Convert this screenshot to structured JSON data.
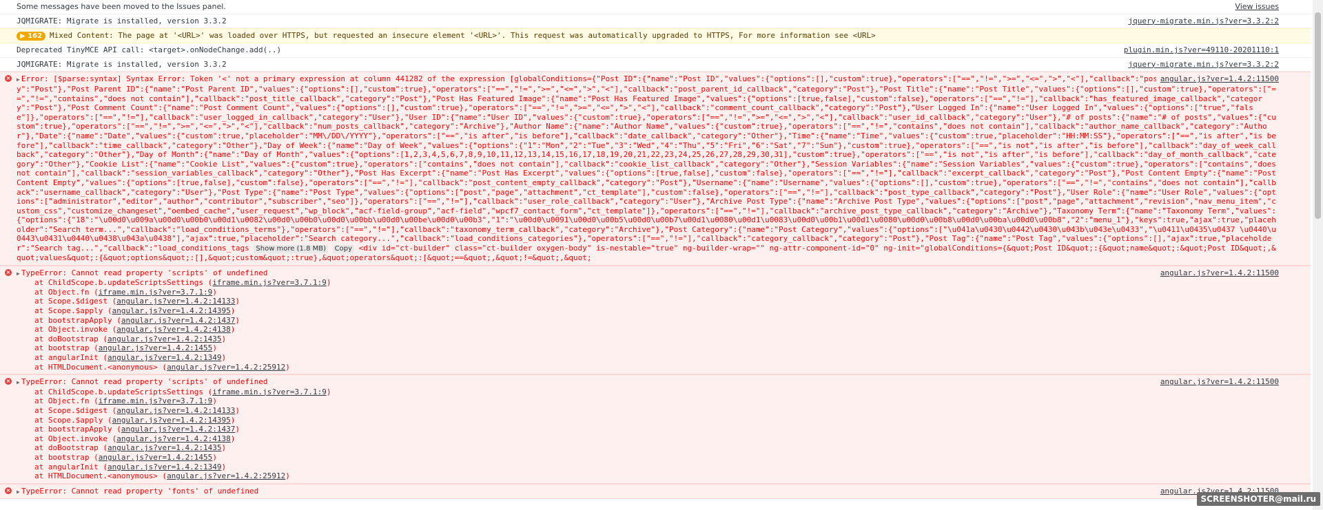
{
  "rows": [
    {
      "type": "info",
      "text": "Some messages have been moved to the Issues panel.",
      "src": "View issues"
    },
    {
      "type": "log",
      "text": "JQMIGRATE: Migrate is installed, version 3.3.2",
      "src": "jquery-migrate.min.js?ver=3.3.2:2"
    },
    {
      "type": "warn",
      "badge": "162",
      "text": "Mixed Content: The page at '<URL>' was loaded over HTTPS, but requested an insecure element '<URL>'. This request was automatically upgraded to HTTPS, For more information see <URL>",
      "src": ""
    },
    {
      "type": "log",
      "text": "Deprecated TinyMCE API call: <target>.onNodeChange.add(..)",
      "src": "plugin.min.js?ver=49110-20201110:1"
    },
    {
      "type": "log",
      "text": "JQMIGRATE: Migrate is installed, version 3.3.2",
      "src": "jquery-migrate.min.js?ver=3.3.2:2"
    },
    {
      "type": "error",
      "text": "Error: [$parse:syntax] Syntax Error: Token '<' not a primary expression at column 441282 of the expression [globalConditions={\"Post ID\":{\"name\":\"Post ID\",\"values\":{\"options\":[],\"custom\":true},\"operators\":[\"==\",\"!=\",\">=\",\"<=\",\">\",\"<\"],\"callback\":\"post_id_callback\",\"category\":\"Post\"},\"Post Parent ID\":{\"name\":\"Post Parent ID\",\"values\":{\"options\":[],\"custom\":true},\"operators\":[\"==\",\"!=\",\">=\",\"<=\",\">\",\"<\"],\"callback\":\"post_parent_id_callback\",\"category\":\"Post\"},\"Post Title\":{\"name\":\"Post Title\",\"values\":{\"options\":[],\"custom\":true},\"operators\":[\"==\",\"!=\",\"contains\",\"does not contain\"],\"callback\":\"post_title_callback\",\"category\":\"Post\"},\"Post Has Featured Image\":{\"name\":\"Post Has Featured Image\",\"values\":{\"options\":[true,false],\"custom\":false},\"operators\":[\"==\",\"!=\"],\"callback\":\"has_featured_image_callback\",\"category\":\"Post\"},\"Post Comment Count\":{\"name\":\"Post Comment Count\",\"values\":{\"options\":[],\"custom\":true},\"operators\":[\"==\",\"!=\",\">=\",\"<=\",\">\",\"<\"],\"callback\":\"comment_count_callback\",\"category\":\"Post\"},\"User Logged In\":{\"name\":\"User Logged In\",\"values\":{\"options\":[\"true\",\"false\"]},\"operators\":[\"==\",\"!=\"],\"callback\":\"user_logged_in_callback\",\"category\":\"User\"},\"User ID\":{\"name\":\"User ID\",\"values\":{\"custom\":true},\"operators\":[\"==\",\"!=\",\">=\",\"<=\",\">\",\"<\"],\"callback\":\"user_id_callback\",\"category\":\"User\"},\"# of posts\":{\"name\":\"# of posts\",\"values\":{\"custom\":true},\"operators\":[\"==\",\"!=\",\">=\",\"<=\",\">\",\"<\"],\"callback\":\"num_posts_callback\",\"category\":\"Archive\"},\"Author Name\":{\"name\":\"Author Name\",\"values\":{\"custom\":true},\"operators\":[\"==\",\"!=\",\"contains\",\"does not contain\"],\"callback\":\"author_name_callback\",\"category\":\"Author\"},\"Date\":{\"name\":\"Date\",\"values\":{\"custom\":true,\"placeholder\":\"MM\\/DD\\/YYYY\"},\"operators\":[\"==\",\"is after\",\"is before\"],\"callback\":\"date_callback\",\"category\":\"Other\"},\"Time\":{\"name\":\"Time\",\"values\":{\"custom\":true,\"placeholder\":\"HH:MM:SS\"},\"operators\":[\"==\",\"is after\",\"is before\"],\"callback\":\"time_callback\",\"category\":\"Other\"},\"Day of Week\":{\"name\":\"Day of Week\",\"values\":{\"options\":{\"1\":\"Mon\",\"2\":\"Tue\",\"3\":\"Wed\",\"4\":\"Thu\",\"5\":\"Fri\",\"6\":\"Sat\",\"7\":\"Sun\"},\"custom\":true},\"operators\":[\"==\",\"is not\",\"is after\",\"is before\"],\"callback\":\"day_of_week_callback\",\"category\":\"Other\"},\"Day of Month\":{\"name\":\"Day of Month\",\"values\":{\"options\":[1,2,3,4,5,6,7,8,9,10,11,12,13,14,15,16,17,18,19,20,21,22,23,24,25,26,27,28,29,30,31],\"custom\":true},\"operators\":[\"==\",\"is not\",\"is after\",\"is before\"],\"callback\":\"day_of_month_callback\",\"category\":\"Other\"},\"Cookie List\":{\"name\":\"Cookie List\",\"values\":{\"custom\":true},\"operators\":[\"contains\",\"does not contain\"],\"callback\":\"cookie_list_callback\",\"category\":\"Other\"},\"Session Variables\":{\"name\":\"Session Variables\",\"values\":{\"custom\":true},\"operators\":[\"contains\",\"does not contain\"],\"callback\":\"session_variables_callback\",\"category\":\"Other\"},\"Post Has Excerpt\":{\"name\":\"Post Has Excerpt\",\"values\":{\"options\":[true,false],\"custom\":false},\"operators\":[\"==\",\"!=\"],\"callback\":\"excerpt_callback\",\"category\":\"Post\"},\"Post Content Empty\":{\"name\":\"Post Content Empty\",\"values\":{\"options\":[true,false],\"custom\":false},\"operators\":[\"==\",\"!=\"],\"callback\":\"post_content_empty_callback\",\"category\":\"Post\"},\"Username\":{\"name\":\"Username\",\"values\":{\"options\":[],\"custom\":true},\"operators\":[\"==\",\"!=\",\"contains\",\"does not contain\"],\"callback\":\"username_callback\",\"category\":\"User\"},\"Post Type\":{\"name\":\"Post Type\",\"values\":{\"options\":[\"post\",\"page\",\"attachment\",\"ct_template\"],\"custom\":false},\"operators\":[\"==\",\"!=\"],\"callback\":\"post_type_callback\",\"category\":\"Post\"},\"User Role\":{\"name\":\"User Role\",\"values\":{\"options\":[\"administrator\",\"editor\",\"author\",\"contributor\",\"subscriber\",\"seo\"]},\"operators\":[\"==\",\"!=\"],\"callback\":\"user_role_callback\",\"category\":\"User\"},\"Archive Post Type\":{\"name\":\"Archive Post Type\",\"values\":{\"options\":[\"post\",\"page\",\"attachment\",\"revision\",\"nav_menu_item\",\"custom_css\",\"customize_changeset\",\"oembed_cache\",\"user_request\",\"wp_block\",\"acf-field-group\",\"acf-field\",\"wpcf7_contact_form\",\"ct_template\"]},\"operators\":[\"==\",\"!=\"],\"callback\":\"archive_post_type_callback\",\"category\":\"Archive\"},\"Taxonomy Term\":{\"name\":\"Taxonomy Term\",\"values\":{\"options\":{\"18\":\"\\u00d0\\u009a\\u00d0\\u00b0\\u00d1\\u0082\\u00d0\\u00b0\\u00d0\\u00bb\\u00d0\\u00be\\u00d0\\u00b3\",\"1\":\"\\u00d0\\u0091\\u00d0\\u00b5\\u00d0\\u00b7\\u00d1\\u0080\\u00d1\\u0083\\u00d0\\u00b1\\u00d1\\u0080\\u00d0\\u00b8\\u00d0\\u00ba\\u00d0\\u00b8\",\"2\":\"menu_1\"},\"keys\":true,\"ajax\":true,\"placeholder\":\"Search term...\",\"callback\":\"load_conditions_terms\"},\"operators\":[\"==\",\"!=\"],\"callback\":\"taxonomy_term_callback\",\"category\":\"Archive\"},\"Post Category\":{\"name\":\"Post Category\",\"values\":{\"options\":[\"\\u041a\\u0430\\u0442\\u0430\\u043b\\u043e\\u0433\",\"\\u0411\\u0435\\u0437 \\u0440\\u0443\\u0431\\u0440\\u0438\\u043a\\u0438\"],\"ajax\":true,\"placeholder\":\"Search category...\",\"callback\":\"load_conditions_categories\"},\"operators\":[\"==\",\"!=\"],\"callback\":\"category_callback\",\"category\":\"Post\"},\"Post Tag\":{\"name\":\"Post Tag\",\"values\":{\"options\":[],\"ajax\":true,\"placeholder\":\"Search tag...\",\"callback\":\"load_conditions_tags",
      "showmore": "Show more (1.8 MB)",
      "copy": "Copy",
      "tail": " <div id=\"ct-builder\" class=\"ct-builder oxygen-body\" is-nestable=\"true\" ng-builder-wrap=\"\" ng-attr-component-id=\"0\" ng-init=\"globalConditions={&quot;Post ID&quot;:{&quot;name&quot;:&quot;Post ID&quot;,&quot;values&quot;:{&quot;options&quot;:[],&quot;custom&quot;:true},&quot;operators&quot;:[&quot;==&quot;,&quot;!=&quot;,&quot;",
      "src": "angular.js?ver=1.4.2:11500"
    },
    {
      "type": "stack",
      "text": "TypeError: Cannot read property 'scripts' of undefined",
      "src": "angular.js?ver=1.4.2:11500",
      "frames": [
        {
          "fn": "at ChildScope.b.updateScriptsSettings",
          "loc": "iframe.min.js?ver=3.7.1:9"
        },
        {
          "fn": "at Object.fn",
          "loc": "iframe.min.js?ver=3.7.1:9"
        },
        {
          "fn": "at Scope.$digest",
          "loc": "angular.js?ver=1.4.2:14133"
        },
        {
          "fn": "at Scope.$apply",
          "loc": "angular.js?ver=1.4.2:14395"
        },
        {
          "fn": "at bootstrapApply",
          "loc": "angular.js?ver=1.4.2:1437"
        },
        {
          "fn": "at Object.invoke",
          "loc": "angular.js?ver=1.4.2:4138"
        },
        {
          "fn": "at doBootstrap",
          "loc": "angular.js?ver=1.4.2:1435"
        },
        {
          "fn": "at bootstrap",
          "loc": "angular.js?ver=1.4.2:1455"
        },
        {
          "fn": "at angularInit",
          "loc": "angular.js?ver=1.4.2:1349"
        },
        {
          "fn": "at HTMLDocument.<anonymous>",
          "loc": "angular.js?ver=1.4.2:25912"
        }
      ]
    },
    {
      "type": "stack",
      "text": "TypeError: Cannot read property 'scripts' of undefined",
      "src": "angular.js?ver=1.4.2:11500",
      "frames": [
        {
          "fn": "at ChildScope.b.updateScriptsSettings",
          "loc": "iframe.min.js?ver=3.7.1:9"
        },
        {
          "fn": "at Object.fn",
          "loc": "iframe.min.js?ver=3.7.1:9"
        },
        {
          "fn": "at Scope.$digest",
          "loc": "angular.js?ver=1.4.2:14133"
        },
        {
          "fn": "at Scope.$apply",
          "loc": "angular.js?ver=1.4.2:14395"
        },
        {
          "fn": "at bootstrapApply",
          "loc": "angular.js?ver=1.4.2:1437"
        },
        {
          "fn": "at Object.invoke",
          "loc": "angular.js?ver=1.4.2:4138"
        },
        {
          "fn": "at doBootstrap",
          "loc": "angular.js?ver=1.4.2:1435"
        },
        {
          "fn": "at bootstrap",
          "loc": "angular.js?ver=1.4.2:1455"
        },
        {
          "fn": "at angularInit",
          "loc": "angular.js?ver=1.4.2:1349"
        },
        {
          "fn": "at HTMLDocument.<anonymous>",
          "loc": "angular.js?ver=1.4.2:25912"
        }
      ]
    },
    {
      "type": "stack",
      "text": "TypeError: Cannot read property 'fonts' of undefined",
      "src": "angular.js?ver=1.4.2:11500",
      "frames": []
    }
  ],
  "watermark": "SCREENSHOTER@mail.ru",
  "colors": {
    "error_text": "#ff0000",
    "error_bg": "#fff0f0",
    "warn_bg": "#fffbe5",
    "badge": "#f2a600"
  }
}
